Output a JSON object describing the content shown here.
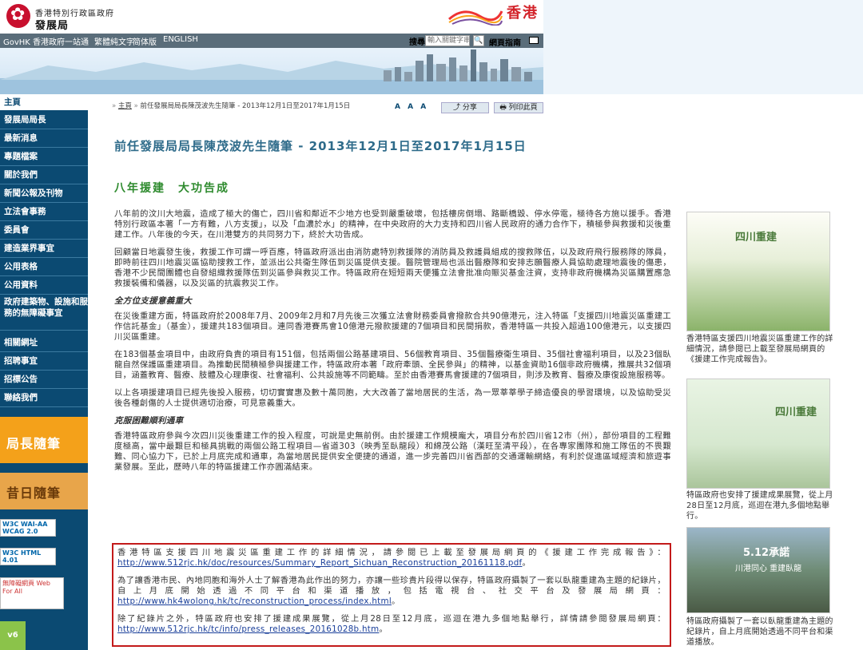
{
  "header": {
    "gov_line1": "香港特別行政區政府",
    "gov_line2": "發展局",
    "brand_text": "香港",
    "govhk_label": "GovHK 香港政府一站通",
    "lang_trad": "繁體純文字",
    "lang_simp": "简体版",
    "lang_en": "ENGLISH",
    "search_label": "搜尋",
    "search_placeholder": "輸入關鍵字串",
    "search_button": "🔍",
    "sitemap_label": "網頁指南"
  },
  "sidebar": {
    "items": [
      {
        "label": "主頁"
      },
      {
        "label": "發展局局長"
      },
      {
        "label": "最新消息"
      },
      {
        "label": "專題檔案"
      },
      {
        "label": "關於我們"
      },
      {
        "label": "新聞公報及刊物"
      },
      {
        "label": "立法會事務"
      },
      {
        "label": "委員會"
      },
      {
        "label": "建造業界事宜"
      },
      {
        "label": "公用表格"
      },
      {
        "label": "公用資料"
      },
      {
        "label": "政府建築物、設施和服務的無障礙事宜"
      },
      {
        "label": "相關網址"
      },
      {
        "label": "招聘事宜"
      },
      {
        "label": "招標公告"
      },
      {
        "label": "聯絡我們"
      }
    ],
    "badge_column": "局長隨筆",
    "badge_past": "昔日隨筆",
    "w3c_aa": "W3C WAI-AA WCAG 2.0",
    "w3c_html": "W3C HTML 4.01",
    "web_for_all": "無障礙網頁 Web For All",
    "ipv6": "v6"
  },
  "breadcrumb": {
    "home": "主頁",
    "current": "前任發展局局長陳茂波先生隨筆 - 2013年12月1日至2017年1月15日",
    "font_size": "A A A",
    "share": "分享",
    "print": "列印此頁"
  },
  "article": {
    "title": "前任發展局局長陳茂波先生隨筆 - 2013年12月1日至2017年1月15日",
    "heading": "八年援建　大功告成",
    "p1": "八年前的汶川大地震，造成了極大的傷亡，四川省和鄰近不少地方也受到嚴重破壞，包括樓房倒塌、路斷橋毀、停水停電，極待各方施以援手。香港特別行政區本著「一方有難，八方支援」，以及「血濃於水」的精神，在中央政府的大力支持和四川省人民政府的通力合作下，積極參與救援和災後重建工作。八年後的今天，在川港雙方的共同努力下，終於大功告成。",
    "p2": "回顧當日地震發生後，救援工作可謂一呼百應，特區政府派出由消防處特別救援隊的消防員及救護員組成的搜救隊伍，以及政府飛行服務隊的隊員，即時前往四川地震災區協助搜救工作，並派出公共衞生隊伍到災區提供支援。醫院管理局也派出醫療隊和安排志願醫療人員協助處理地震後的傷患，香港不少民間團體也自發組織救援隊伍到災區參與救災工作。特區政府在短短兩天便獲立法會批准向賑災基金注資，支持非政府機構為災區購置應急救援裝備和儀器，以及災區的抗震救災工作。",
    "h3a": "全方位支援意義重大",
    "p3": "在災後重建方面，特區政府於2008年7月、2009年2月和7月先後三次獲立法會財務委員會撥款合共90億港元，注入特區「支援四川地震災區重建工作信託基金」（基金），援建共183個項目。連同香港賽馬會10億港元撥款援建的7個項目和民間捐款，香港特區一共投入超過100億港元，以支援四川災區重建。",
    "p4": "在183個基金項目中，由政府負責的項目有151個，包括兩個公路基建項目、56個教育項目、35個醫療衞生項目、35個社會福利項目，以及23個臥龍自然保護區重建項目。為推動民間積極參與援建工作，特區政府本著「政府牽頭、全民參與」的精神，以基金資助16個非政府機構，推展共32個項目，涵蓋教育、醫療、肢體及心理康復、社會福利、公共設施等不同範疇。至於由香港賽馬會援建的7個項目，則涉及教育、醫療及康復設施服務等。",
    "p5": "以上各項援建項目已經先後投入服務，切切實實惠及數十萬同胞，大大改善了當地居民的生活，為一眾莘莘學子締造優良的學習環境，以及協助受災後各種創傷的人士提供適切治療，可見意義重大。",
    "h3b": "克服困難順利通車",
    "p6": "香港特區政府參與今次四川災後重建工作的投入程度，可說是史無前例。由於援建工作規模龐大，項目分布於四川省12市（州），部份項目的工程難度極高，當中最艱巨和極具挑戰的兩個公路工程項目—省道303（映秀至臥龍段）和綿茂公路（漢旺至清平段），在各專家團隊和施工隊伍的不畏艱難、同心協力下，已於上月底完成和通車，為當地居民提供安全便捷的通道，進一步完善四川省西部的交通運輸網絡，有利於促進區域經濟和旅遊事業發展。至此，歷時八年的特區援建工作亦圓滿結束。"
  },
  "highlight": {
    "p1_text": "香港特區支援四川地震災區重建工作的詳細情況，請參閱已上載至發展局網頁的《援建工作完成報告》：",
    "p1_link": "http://www.512rjc.hk/doc/resources/Summary_Report_Sichuan_Reconstruction_20161118.pdf",
    "p1_end": "。",
    "p2_text": "為了讓香港市民、內地同胞和海外人士了解香港為此作出的努力，亦讓一些珍貴片段得以保存，特區政府攝製了一套以臥龍重建為主題的紀錄片，自上月底開始透過不同平台和渠道播放，包括電視台、社交平台及發展局網頁：",
    "p2_link": "http://www.hk4wolong.hk/tc/reconstruction_process/index.html",
    "p2_end": "。",
    "p3_text": "除了紀錄片之外，特區政府也安排了援建成果展覽，從上月28日至12月底，巡迴在港九多個地點舉行，詳情請參閱發展局網頁：",
    "p3_link": "http://www.512rjc.hk/tc/info/press_releases_20161028b.htm",
    "p3_end": "。"
  },
  "right_column": {
    "promo1_title": "四川重建",
    "caption1": "香港特區支援四川地震災區重建工作的詳細情況，請參閱已上載至發展局網頁的《援建工作完成報告》。",
    "promo2_title": "四川重建",
    "caption2": "特區政府也安排了援建成果展覽，從上月28日至12月底，巡迴在港九多個地點舉行。",
    "promo3_title": "5.12承諾",
    "promo3_sub": "川港同心 重建臥龍",
    "caption3": "特區政府攝製了一套以臥龍重建為主題的紀錄片，自上月底開始透過不同平台和渠道播放。"
  }
}
